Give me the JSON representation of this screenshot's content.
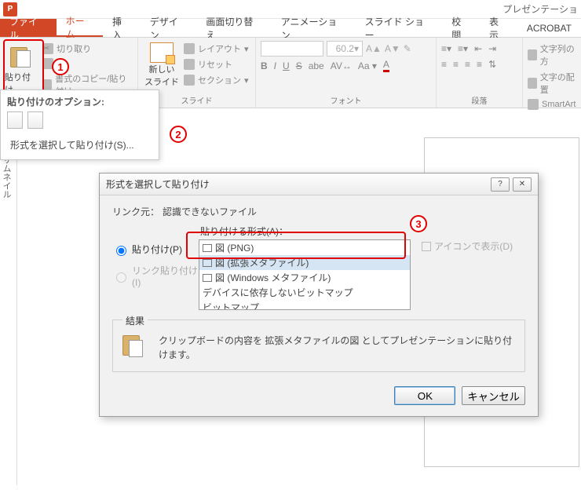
{
  "title": "プレゼンテーショ",
  "tabs": {
    "file": "ファイル",
    "home": "ホーム",
    "insert": "挿入",
    "design": "デザイン",
    "transitions": "画面切り替え",
    "animations": "アニメーション",
    "slideshow": "スライド ショー",
    "review": "校閲",
    "view": "表示",
    "acrobat": "ACROBAT"
  },
  "ribbon": {
    "clipboard": {
      "paste": "貼り付け",
      "cut": "切り取り",
      "copy_format": "書式のコピー/貼り付け"
    },
    "slides": {
      "new_slide": "新しい\nスライド",
      "layout": "レイアウト",
      "reset": "リセット",
      "section": "セクション",
      "group": "スライド"
    },
    "font": {
      "size": "60.2",
      "group": "フォント"
    },
    "paragraph": {
      "text_dir": "文字列の方",
      "text_align": "文字の配置",
      "smartart": "SmartArt",
      "group": "段落"
    }
  },
  "paste_panel": {
    "title": "貼り付けのオプション:",
    "special": "形式を選択して貼り付け(S)..."
  },
  "thumb_rail": "サムネイル",
  "dialog": {
    "title": "形式を選択して貼り付け",
    "link_src_label": "リンク元：",
    "link_src_value": "認識できないファイル",
    "format_label": "貼り付ける形式(A)：",
    "radio_paste": "貼り付け(P)",
    "radio_link": "リンク貼り付け(I)",
    "icon_display": "アイコンで表示(D)",
    "list": {
      "png": "図 (PNG)",
      "emf": "図 (拡張メタファイル)",
      "wmf": "図 (Windows メタファイル)",
      "dib": "デバイスに依存しないビットマップ",
      "bmp": "ビットマップ"
    },
    "result_label": "結果",
    "result_text": "クリップボードの内容を 拡張メタファイルの図 としてプレゼンテーションに貼り付けます。",
    "ok": "OK",
    "cancel": "キャンセル"
  },
  "callouts": {
    "c1": "1",
    "c2": "2",
    "c3": "3"
  }
}
